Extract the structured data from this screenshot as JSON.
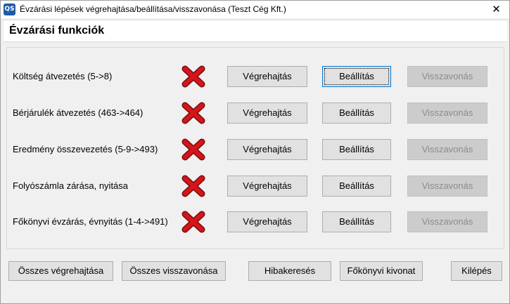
{
  "window": {
    "app_icon_text": "QS",
    "title": "Évzárási lépések végrehajtása/beállítása/visszavonása (Teszt Cég Kft.)",
    "close_label": "✕"
  },
  "header": {
    "title": "Évzárási funkciók"
  },
  "rows": [
    {
      "label": "Költség átvezetés (5->8)",
      "status": "error-x-icon",
      "execute": "Végrehajtás",
      "settings": "Beállítás",
      "undo": "Visszavonás"
    },
    {
      "label": "Bérjárulék átvezetés (463->464)",
      "status": "error-x-icon",
      "execute": "Végrehajtás",
      "settings": "Beállítás",
      "undo": "Visszavonás"
    },
    {
      "label": "Eredmény összevezetés (5-9->493)",
      "status": "error-x-icon",
      "execute": "Végrehajtás",
      "settings": "Beállítás",
      "undo": "Visszavonás"
    },
    {
      "label": "Folyószámla zárása, nyitása",
      "status": "error-x-icon",
      "execute": "Végrehajtás",
      "settings": "Beállítás",
      "undo": "Visszavonás"
    },
    {
      "label": "Főkönyvi évzárás, évnyitás (1-4->491)",
      "status": "error-x-icon",
      "execute": "Végrehajtás",
      "settings": "Beállítás",
      "undo": "Visszavonás"
    }
  ],
  "footer": {
    "execute_all": "Összes végrehajtása",
    "undo_all": "Összes visszavonása",
    "debug": "Hibakeresés",
    "ledger_extract": "Főkönyvi kivonat",
    "exit": "Kilépés"
  },
  "colors": {
    "error_red": "#d4151b",
    "focus_blue": "#0078d7"
  }
}
